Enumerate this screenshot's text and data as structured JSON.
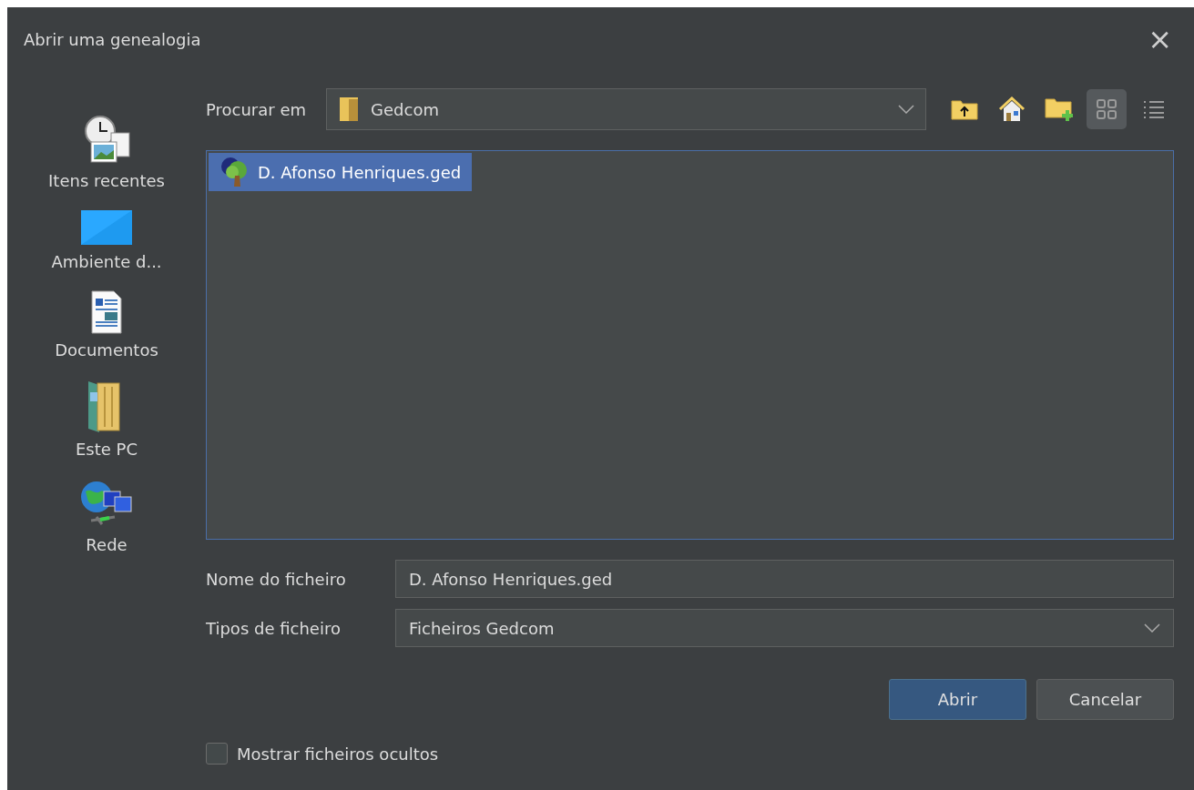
{
  "window": {
    "title": "Abrir uma genealogia",
    "close": "×"
  },
  "sidebar": {
    "items": [
      {
        "label": "Itens recentes",
        "kind": "recent"
      },
      {
        "label": "Ambiente d...",
        "kind": "desktop"
      },
      {
        "label": "Documentos",
        "kind": "documents"
      },
      {
        "label": "Este PC",
        "kind": "computer"
      },
      {
        "label": "Rede",
        "kind": "network"
      }
    ]
  },
  "look_in": {
    "label": "Procurar em",
    "value": "Gedcom"
  },
  "toolbar": [
    {
      "kind": "up",
      "selected": false
    },
    {
      "kind": "home",
      "selected": false
    },
    {
      "kind": "new-folder",
      "selected": false
    },
    {
      "kind": "grid",
      "selected": true
    },
    {
      "kind": "list",
      "selected": false
    }
  ],
  "files": [
    {
      "name": "D. Afonso Henriques.ged",
      "selected": true
    }
  ],
  "file_name": {
    "label": "Nome do ficheiro",
    "value": "D. Afonso Henriques.ged"
  },
  "file_type": {
    "label": "Tipos de ficheiro",
    "value": "Ficheiros Gedcom"
  },
  "buttons": [
    {
      "label": "Abrir",
      "kind": "primary"
    },
    {
      "label": "Cancelar",
      "kind": "secondary"
    }
  ],
  "show_hidden": {
    "label": "Mostrar ficheiros ocultos",
    "checked": false
  }
}
